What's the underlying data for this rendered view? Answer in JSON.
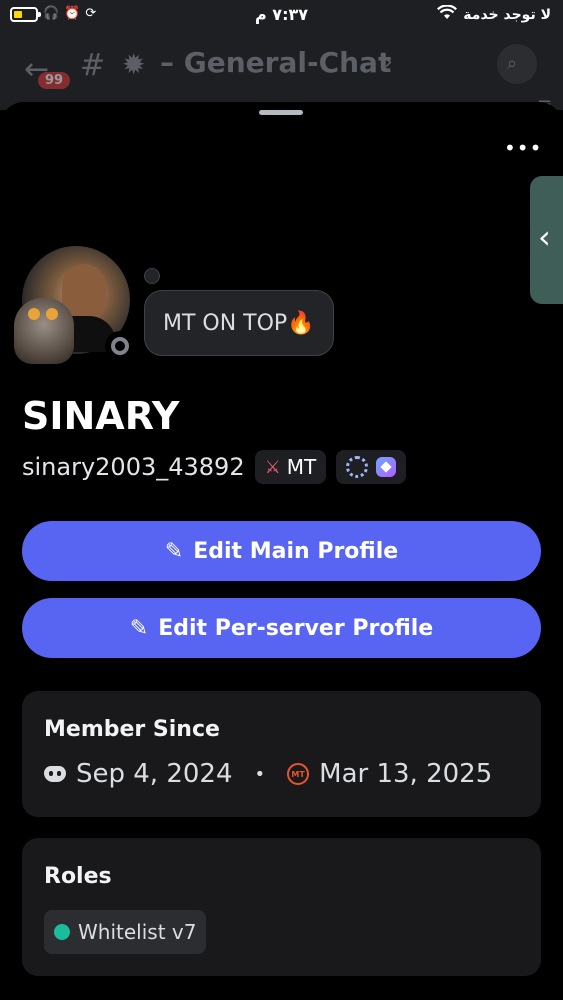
{
  "status_bar": {
    "time": "٧:٣٧ م",
    "carrier": "لا توجد خدمة",
    "glyphs": [
      "headphones-icon",
      "alarm-icon",
      "rotation-lock-icon"
    ]
  },
  "background_header": {
    "unread_badge": "99",
    "channel_name": "– General-Chat"
  },
  "profile": {
    "display_name": "SINARY",
    "username": "sinary2003_43892",
    "custom_status": "MT ON TOP🔥",
    "server_tag": "MT",
    "status": "offline"
  },
  "actions": {
    "edit_main": "Edit Main Profile",
    "edit_server": "Edit Per-server Profile"
  },
  "member_since": {
    "title": "Member Since",
    "discord_date": "Sep 4, 2024",
    "separator": "•",
    "server_date": "Mar 13, 2025",
    "server_icon_label": "MT"
  },
  "roles": {
    "title": "Roles",
    "items": [
      {
        "name": "Whitelist v7",
        "color": "#1abc9c"
      }
    ]
  },
  "colors": {
    "accent": "#5865f2",
    "background": "#000000",
    "card": "#19191c"
  }
}
